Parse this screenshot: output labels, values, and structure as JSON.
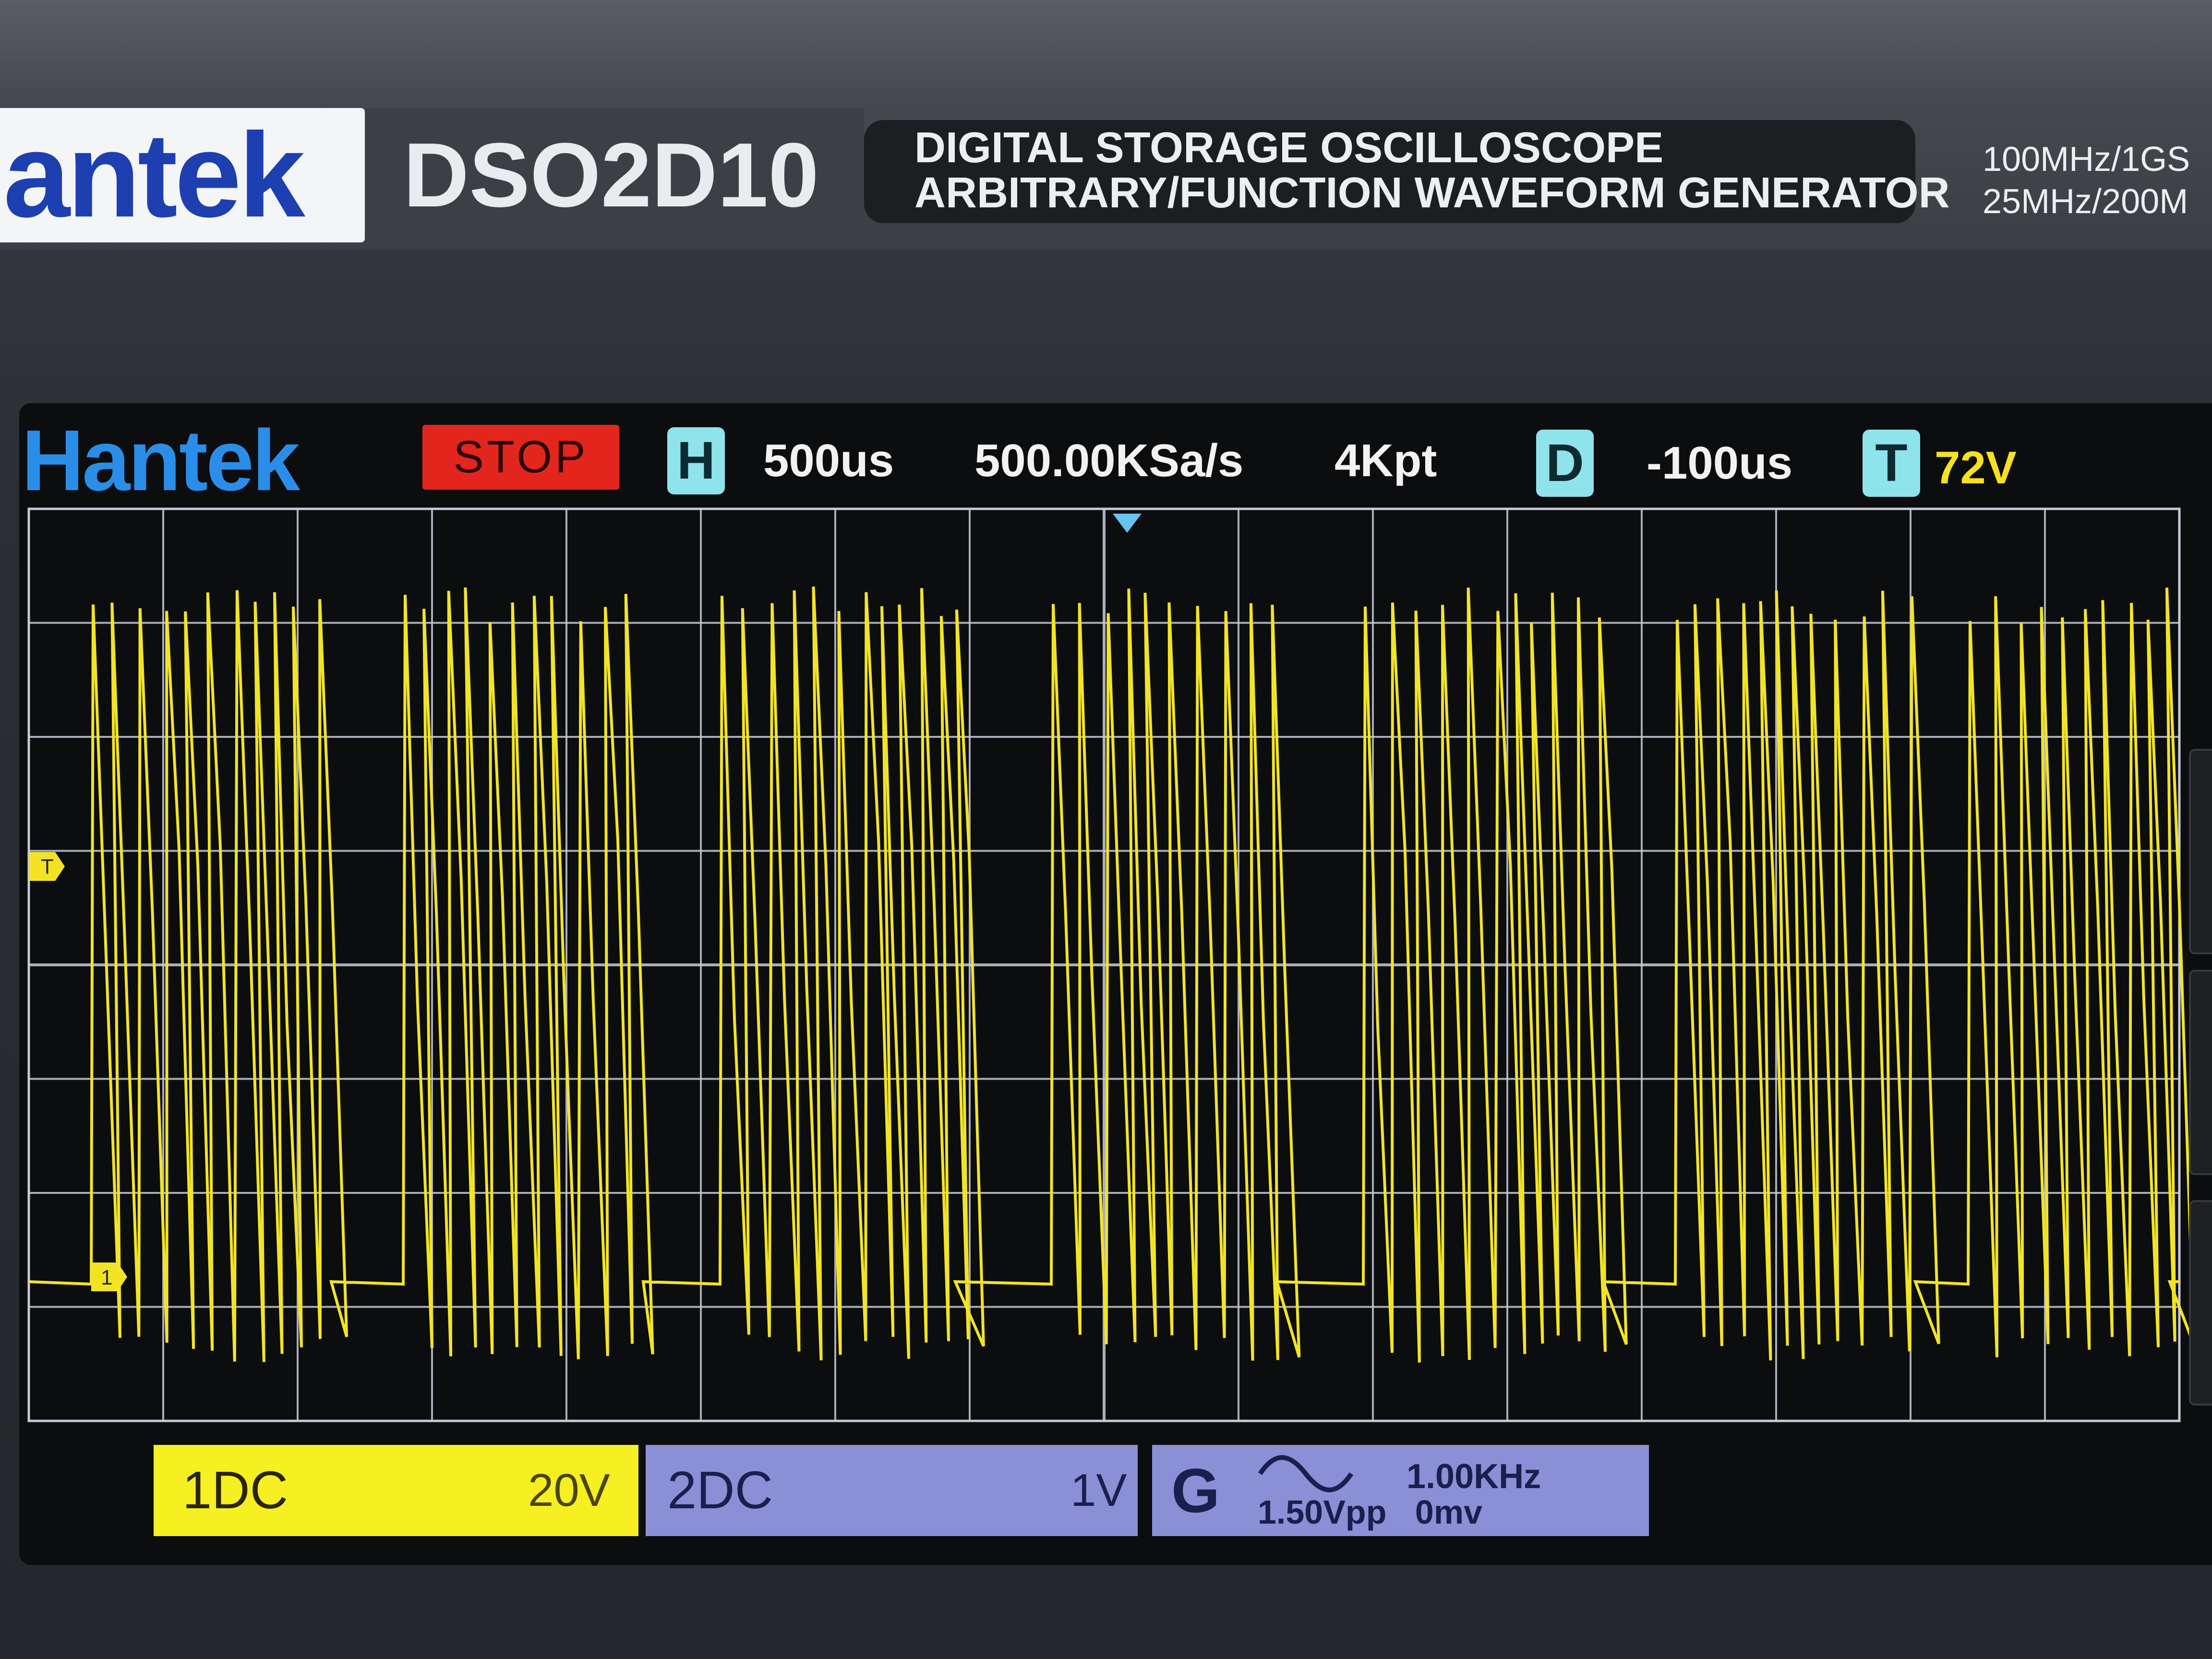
{
  "device": {
    "brand": "antek",
    "model": "DSO2D10",
    "description_line1": "DIGITAL STORAGE OSCILLOSCOPE",
    "description_line2": "ARBITRARY/FUNCTION WAVEFORM GENERATOR",
    "spec_line1": "100MHz/1GS",
    "spec_line2": "25MHz/200M"
  },
  "screen": {
    "logo": "Hantek",
    "run_state": "STOP",
    "horizontal": {
      "icon": "H",
      "timebase": "500us",
      "sample_rate": "500.00KSa/s",
      "memory_depth": "4Kpt"
    },
    "delay": {
      "icon": "D",
      "value": "-100us"
    },
    "trigger": {
      "icon": "T",
      "level": "72V"
    },
    "markers": {
      "trigger_level": "T",
      "channel1_ground": "1"
    },
    "colors": {
      "channel1": "#f2e424",
      "channel2": "#8b8fd6",
      "stop": "#e2261d",
      "grid": "#c9c9d8",
      "logo": "#2a8ee8"
    }
  },
  "status_bar": {
    "channel1": {
      "name": "1DC",
      "scale": "20V"
    },
    "channel2": {
      "name": "2DC",
      "scale": "1V"
    },
    "generator": {
      "letter": "G",
      "waveform_icon": "sine-wave-icon",
      "frequency": "1.00KHz",
      "amplitude": "1.50Vpp",
      "offset": "0mv"
    }
  }
}
